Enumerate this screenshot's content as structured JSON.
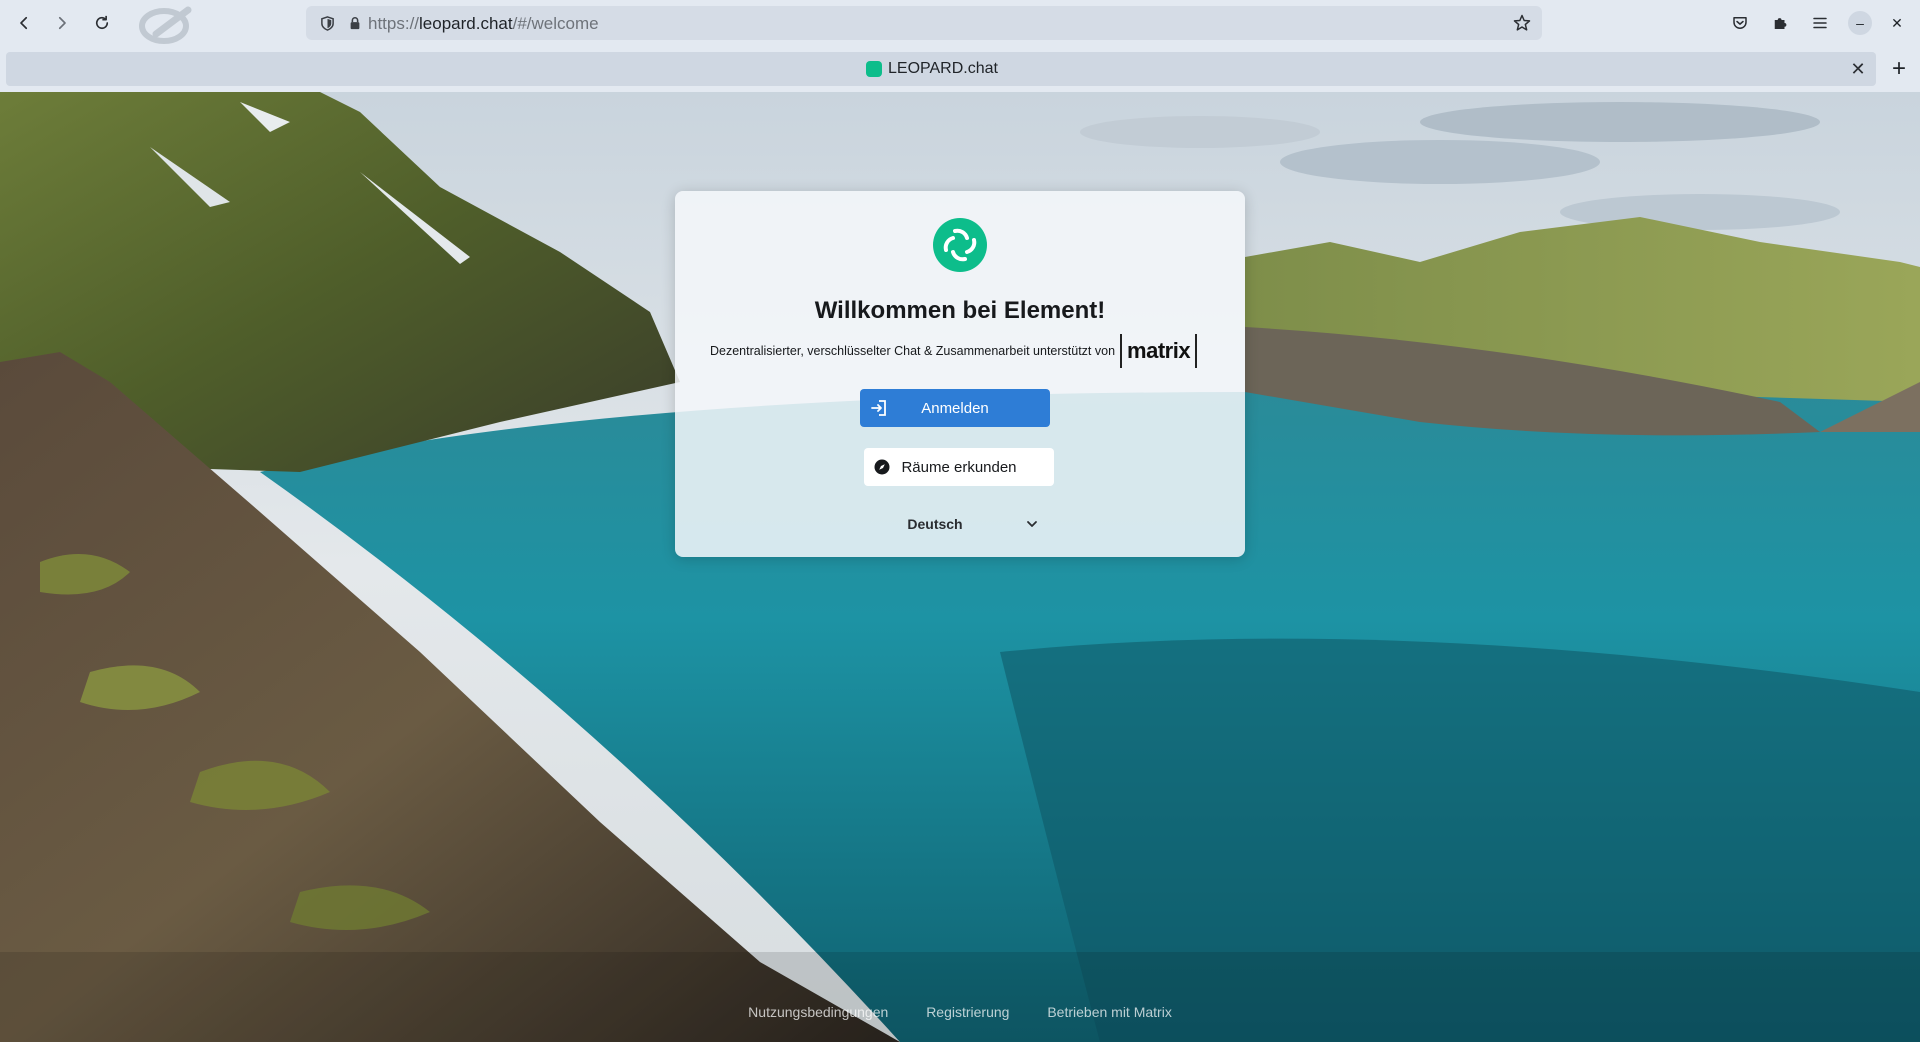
{
  "browser": {
    "url_prefix": "https://",
    "url_domain": "leopard.chat",
    "url_path": "/#/welcome",
    "tab_title": "LEOPARD.chat",
    "icons": {
      "back": "back-arrow-icon",
      "forward": "forward-arrow-icon",
      "reload": "reload-icon",
      "shield": "tracking-shield-icon",
      "lock": "lock-icon",
      "bookmark": "star-icon",
      "pocket": "pocket-icon",
      "extensions": "puzzle-icon",
      "menu": "hamburger-menu-icon",
      "minimize": "minimize-icon",
      "close_window": "close-icon",
      "close_tab": "close-icon",
      "new_tab": "plus-icon"
    },
    "minimize_glyph": "–",
    "close_glyph": "✕",
    "close_tab_glyph": "✕",
    "new_tab_glyph": "+"
  },
  "welcome": {
    "title": "Willkommen bei Element!",
    "subtitle": "Dezentralisierter, verschlüsselter Chat & Zusammenarbeit unterstützt von",
    "matrix_logo_text": "matrix",
    "login_button": "Anmelden",
    "explore_button": "Räume erkunden",
    "language": "Deutsch"
  },
  "footer": {
    "links": [
      "Nutzungsbedingungen",
      "Registrierung",
      "Betrieben mit Matrix"
    ]
  },
  "colors": {
    "accent": "#0dbd8b",
    "primary_button": "#2e7dd6"
  }
}
